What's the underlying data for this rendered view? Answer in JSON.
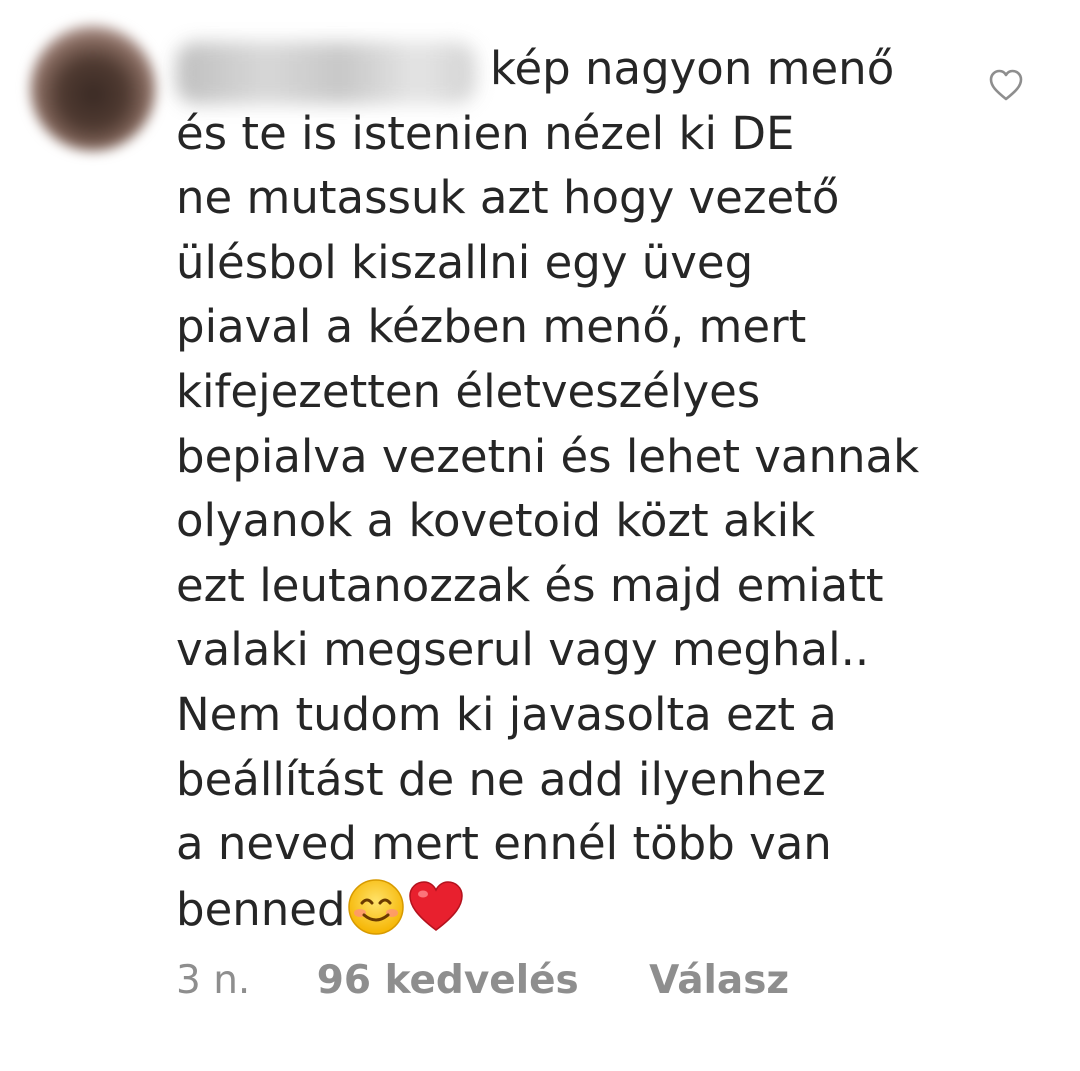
{
  "comment": {
    "lines": [
      "kép nagyon menő",
      "és te is istenien nézel ki DE",
      "ne mutassuk azt hogy vezető",
      "ülésbol kiszallni egy üveg",
      "piaval a kézben menő, mert",
      "kifejezetten életveszélyes",
      "bepialva vezetni és lehet vannak",
      "olyanok a kovetoid közt akik",
      "ezt leutanozzak és majd emiatt",
      "valaki megserul vagy meghal..",
      "Nem tudom ki javasolta ezt a",
      "beállítást de ne add ilyenhez",
      "a neved mert ennél több van",
      "benned"
    ],
    "emojis": [
      "smiling-face-emoji",
      "red-heart-emoji"
    ]
  },
  "meta": {
    "time": "3 n.",
    "likes": "96 kedvelés",
    "reply": "Válasz"
  },
  "icons": {
    "like": "heart-outline-icon"
  },
  "colors": {
    "text": "#262626",
    "secondary": "#8e8e8e",
    "heart": "#e0245e"
  }
}
